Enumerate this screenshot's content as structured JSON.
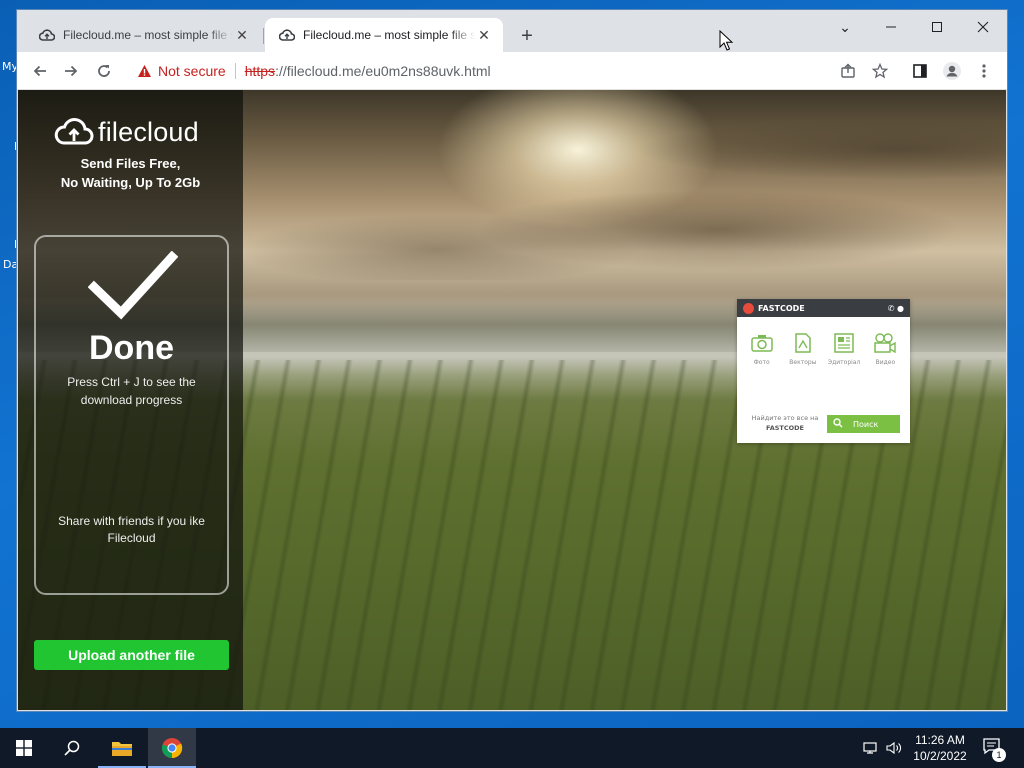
{
  "desktop": {
    "icon_fragments": [
      "My",
      "I",
      "I",
      "Da"
    ]
  },
  "browser": {
    "tabs": [
      {
        "title": "Filecloud.me – most simple file sharing",
        "active": false
      },
      {
        "title": "Filecloud.me – most simple file sharing",
        "active": true
      }
    ],
    "new_tab_label": "+",
    "window_controls": {
      "minimize": "—",
      "maximize": "☐",
      "close": "✕",
      "tab_search": "⌄"
    },
    "omnibox": {
      "security_label": "Not secure",
      "url_scheme": "https",
      "url_rest": "://filecloud.me/eu0m2ns88uvk.html"
    },
    "toolbar_icons": [
      "back-icon",
      "forward-icon",
      "reload-icon",
      "share-icon",
      "star-icon",
      "side-panel-icon",
      "profile-icon",
      "menu-icon"
    ]
  },
  "page": {
    "logo_text": "filecloud",
    "tagline_line1": "Send Files Free,",
    "tagline_line2": "No Waiting, Up To 2Gb",
    "done_title": "Done",
    "done_message": "Press Ctrl + J to see the download progress",
    "share_message": "Share with friends if you ike Filecloud",
    "upload_button": "Upload another file",
    "accent_color": "#20c531"
  },
  "fastcode_widget": {
    "brand": "FASTCODE",
    "categories": [
      {
        "label": "Фото",
        "icon": "camera-icon"
      },
      {
        "label": "Векторы",
        "icon": "vector-file-icon"
      },
      {
        "label": "Эдиторіал",
        "icon": "editorial-icon"
      },
      {
        "label": "Видео",
        "icon": "video-camera-icon"
      }
    ],
    "prompt_text": "Найдите это все на",
    "prompt_brand": "FASTCODE",
    "search_button": "Поиск"
  },
  "taskbar": {
    "time": "11:26 AM",
    "date": "10/2/2022",
    "notification_count": "1",
    "items": [
      "start-icon",
      "search-icon",
      "file-explorer-icon",
      "chrome-icon"
    ]
  }
}
